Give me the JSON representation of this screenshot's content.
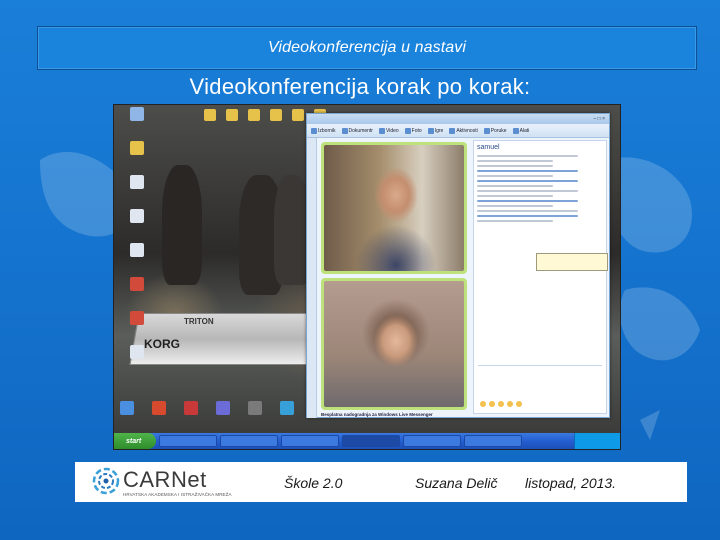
{
  "header": {
    "title": "Videokonferencija u nastavi"
  },
  "slide": {
    "title": "Videokonferencija korak po korak:"
  },
  "screenshot": {
    "desktop_icons_left": [
      "",
      "",
      "",
      "",
      "",
      "",
      "",
      "",
      "",
      ""
    ],
    "messenger": {
      "title": "",
      "toolbar": [
        "Izbornik",
        "Dokumentr",
        "Video",
        "Foto",
        "Igre",
        "Aktivnosti",
        "Poruke",
        "Alati"
      ],
      "contact_name": "samuel",
      "promo": "Besplatna nadogradnja za Windows Live Messenger"
    },
    "taskbar": {
      "start_label": "start",
      "tasks": [
        "",
        "",
        "",
        "",
        "",
        ""
      ]
    }
  },
  "footer": {
    "logo_text": "CARNet",
    "logo_sub": "HRVATSKA AKADEMSKA I ISTRAŽIVAČKA MREŽA",
    "event": "Škole 2.0",
    "author": "Suzana Delič",
    "date": "listopad, 2013."
  },
  "colors": {
    "background": "#1574cf",
    "header_box": "#1a83dc",
    "video_frame": "#bde27c",
    "taskbar": "#245ed0"
  }
}
